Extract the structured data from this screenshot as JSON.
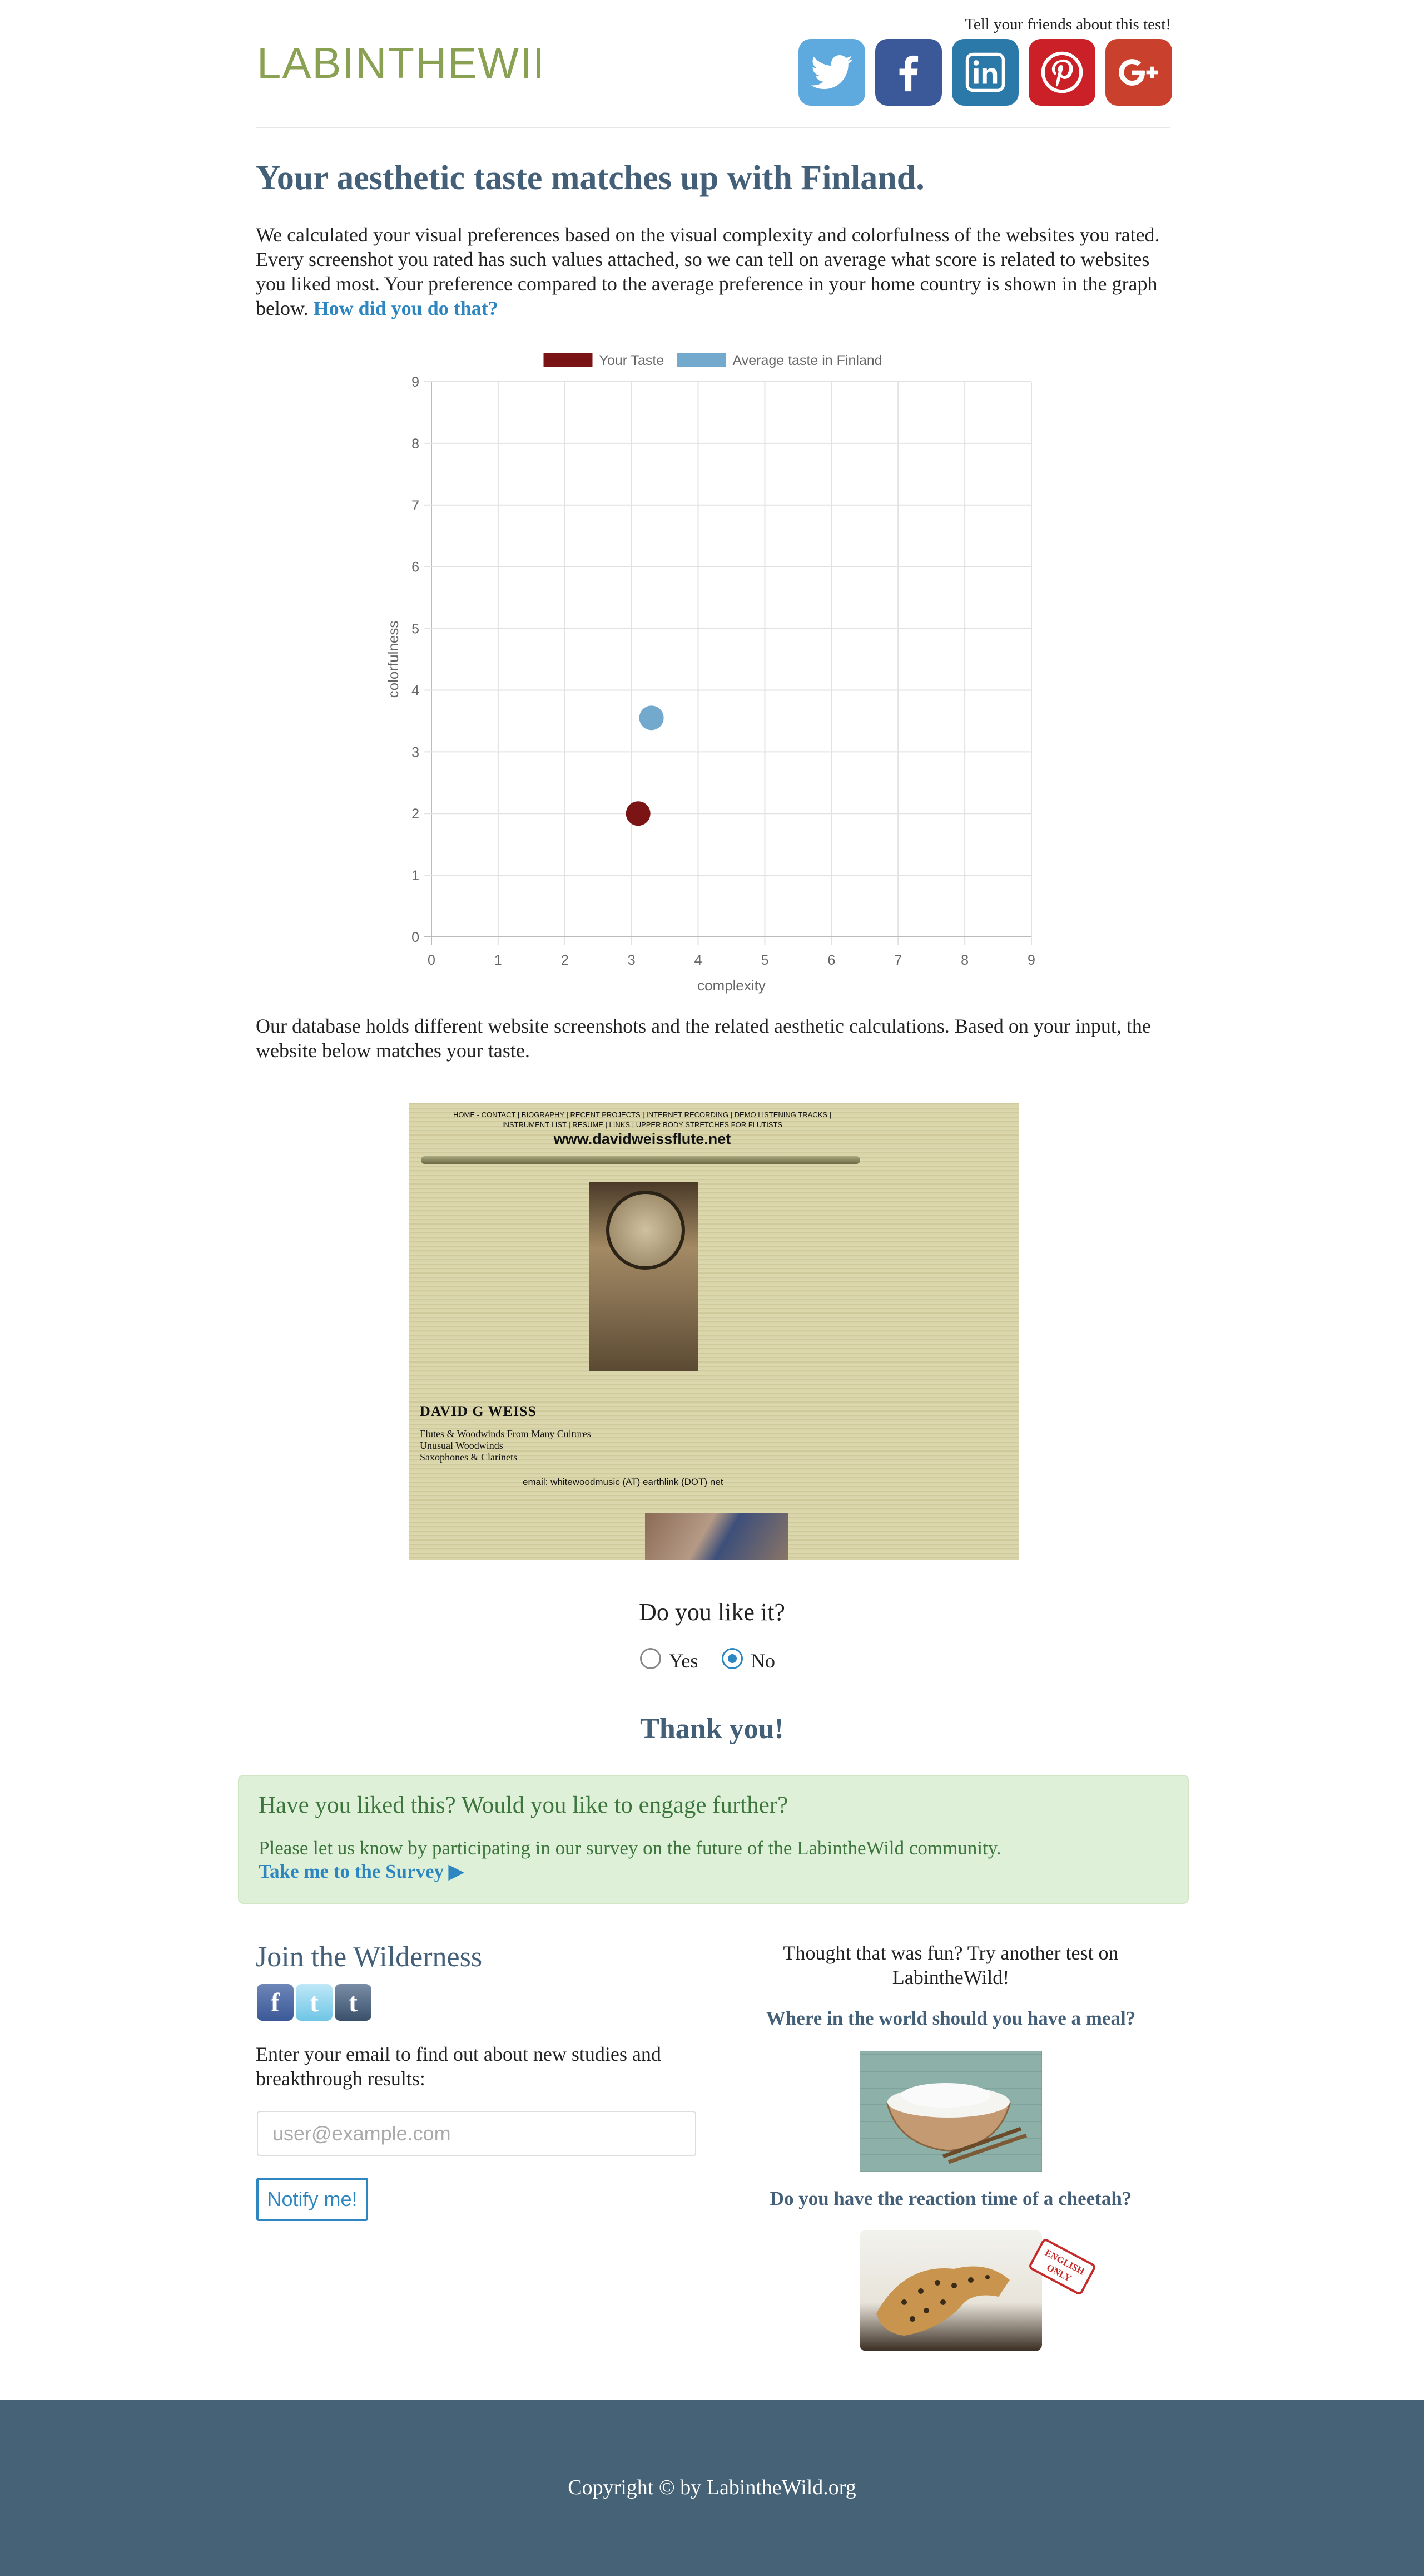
{
  "header": {
    "logo_text": "LABINTHEWILD",
    "share_text": "Tell your friends about this test!",
    "social": [
      {
        "name": "twitter-icon",
        "color": "#5ea9dd"
      },
      {
        "name": "facebook-icon",
        "color": "#3b5998"
      },
      {
        "name": "linkedin-icon",
        "color": "#2b79a8"
      },
      {
        "name": "pinterest-icon",
        "color": "#cb2027"
      },
      {
        "name": "google-plus-icon",
        "color": "#c9412c"
      }
    ]
  },
  "result": {
    "headline": "Your aesthetic taste matches up with Finland.",
    "intro": "We calculated your visual preferences based on the visual complexity and colorfulness of the websites you rated. Every screenshot you rated has such values attached, so we can tell on average what score is related to websites you liked most. Your preference compared to the average preference in your home country is shown in the graph below.",
    "how_link": "How did you do that?"
  },
  "chart_data": {
    "type": "scatter",
    "xlabel": "complexity",
    "ylabel": "colorfulness",
    "xlim": [
      0,
      9
    ],
    "ylim": [
      0,
      9
    ],
    "xticks": [
      "0",
      "1",
      "2",
      "3",
      "4",
      "5",
      "6",
      "7",
      "8",
      "9"
    ],
    "yticks": [
      "0",
      "1",
      "2",
      "3",
      "4",
      "5",
      "6",
      "7",
      "8",
      "9"
    ],
    "grid": true,
    "legend_position": "top",
    "series": [
      {
        "name": "Your Taste",
        "color": "#7b1414",
        "points": [
          {
            "x": 3.1,
            "y": 2.0
          }
        ]
      },
      {
        "name": "Average taste in Finland",
        "color": "#72a9cd",
        "points": [
          {
            "x": 3.3,
            "y": 3.55
          }
        ]
      }
    ]
  },
  "database_text": "Our database holds different website screenshots and the related aesthetic calculations. Based on your input, the website below matches your taste.",
  "website": {
    "nav_line1": "HOME - CONTACT | BIOGRAPHY | RECENT PROJECTS | INTERNET RECORDING | DEMO LISTENING TRACKS |",
    "nav_line2": "INSTRUMENT LIST | RESUME | LINKS | UPPER BODY STRETCHES FOR FLUTISTS",
    "url": "www.davidweissflute.net",
    "name": "DAVID G WEISS",
    "lines": [
      "Flutes & Woodwinds From Many Cultures",
      "Unusual Woodwinds",
      "Saxophones & Clarinets"
    ],
    "email": "email: whitewoodmusic (AT) earthlink (DOT) net"
  },
  "question": {
    "text": "Do you like it?",
    "yes": "Yes",
    "no": "No",
    "selected": "No",
    "thanks": "Thank you!"
  },
  "survey": {
    "title": "Have you liked this? Would you like to engage further?",
    "text": "Please let us know by participating in our survey on the future of the LabintheWild community.",
    "link": "Take me to the Survey ▶"
  },
  "join": {
    "title": "Join the Wilderness",
    "text": "Enter your email to find out about new studies and breakthrough results:",
    "placeholder": "user@example.com",
    "button": "Notify me!"
  },
  "more_tests": {
    "intro": "Thought that was fun? Try another test on LabintheWild!",
    "tests": [
      {
        "title": "Where in the world should you have a meal?"
      },
      {
        "title": "Do you have the reaction time of a cheetah?",
        "stamp": "ENGLISH ONLY"
      }
    ]
  },
  "footer": {
    "copyright": "Copyright © by LabintheWild.org"
  }
}
